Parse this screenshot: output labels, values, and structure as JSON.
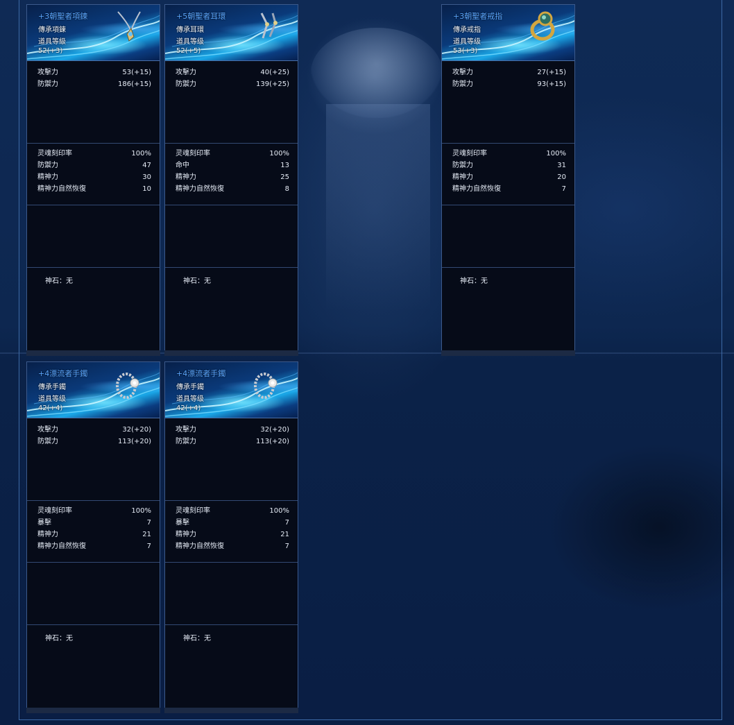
{
  "cards": [
    {
      "name": "+3朝聖者項鍊",
      "type": "傳承項鍊",
      "level_label": "道具等級",
      "level": "52(+3)",
      "icon": "necklace-icon",
      "base_stats": [
        {
          "label": "攻擊力",
          "value": "53(+15)"
        },
        {
          "label": "防禦力",
          "value": "186(+15)"
        }
      ],
      "extra_stats": [
        {
          "label": "灵魂刻印率",
          "value": "100%"
        },
        {
          "label": "防禦力",
          "value": "47"
        },
        {
          "label": "精神力",
          "value": "30"
        },
        {
          "label": "精神力自然恢復",
          "value": "10"
        }
      ],
      "gem": "神石：无"
    },
    {
      "name": "+5朝聖者耳環",
      "type": "傳承耳環",
      "level_label": "道具等级",
      "level": "52(+5)",
      "icon": "earring-icon",
      "base_stats": [
        {
          "label": "攻擊力",
          "value": "40(+25)"
        },
        {
          "label": "防禦力",
          "value": "139(+25)"
        }
      ],
      "extra_stats": [
        {
          "label": "灵魂刻印率",
          "value": "100%"
        },
        {
          "label": "命中",
          "value": "13"
        },
        {
          "label": "精神力",
          "value": "25"
        },
        {
          "label": "精神力自然恢復",
          "value": "8"
        }
      ],
      "gem": "神石：无"
    },
    {
      "name": "+3朝聖者戒指",
      "type": "傳承戒指",
      "level_label": "道具等级",
      "level": "53(+3)",
      "icon": "ring-icon",
      "base_stats": [
        {
          "label": "攻擊力",
          "value": "27(+15)"
        },
        {
          "label": "防禦力",
          "value": "93(+15)"
        }
      ],
      "extra_stats": [
        {
          "label": "灵魂刻印率",
          "value": "100%"
        },
        {
          "label": "防禦力",
          "value": "31"
        },
        {
          "label": "精神力",
          "value": "20"
        },
        {
          "label": "精神力自然恢復",
          "value": "7"
        }
      ],
      "gem": "神石：无"
    },
    {
      "name": "+4漂流者手鐲",
      "type": "傳承手鐲",
      "level_label": "道具等级",
      "level": "42(+4)",
      "icon": "bracelet-icon",
      "base_stats": [
        {
          "label": "攻擊力",
          "value": "32(+20)"
        },
        {
          "label": "防禦力",
          "value": "113(+20)"
        }
      ],
      "extra_stats": [
        {
          "label": "灵魂刻印率",
          "value": "100%"
        },
        {
          "label": "暴擊",
          "value": "7"
        },
        {
          "label": "精神力",
          "value": "21"
        },
        {
          "label": "精神力自然恢復",
          "value": "7"
        }
      ],
      "gem": "神石：无"
    },
    {
      "name": "+4漂流者手鐲",
      "type": "傳承手鐲",
      "level_label": "道具等级",
      "level": "42(+4)",
      "icon": "bracelet-icon",
      "base_stats": [
        {
          "label": "攻擊力",
          "value": "32(+20)"
        },
        {
          "label": "防禦力",
          "value": "113(+20)"
        }
      ],
      "extra_stats": [
        {
          "label": "灵魂刻印率",
          "value": "100%"
        },
        {
          "label": "暴擊",
          "value": "7"
        },
        {
          "label": "精神力",
          "value": "21"
        },
        {
          "label": "精神力自然恢復",
          "value": "7"
        }
      ],
      "gem": "神石：无"
    }
  ],
  "colors": {
    "title": "#5aa6ff",
    "card_bg": "#060b18",
    "border": "#3c5a8c",
    "background": "#0d2750"
  }
}
